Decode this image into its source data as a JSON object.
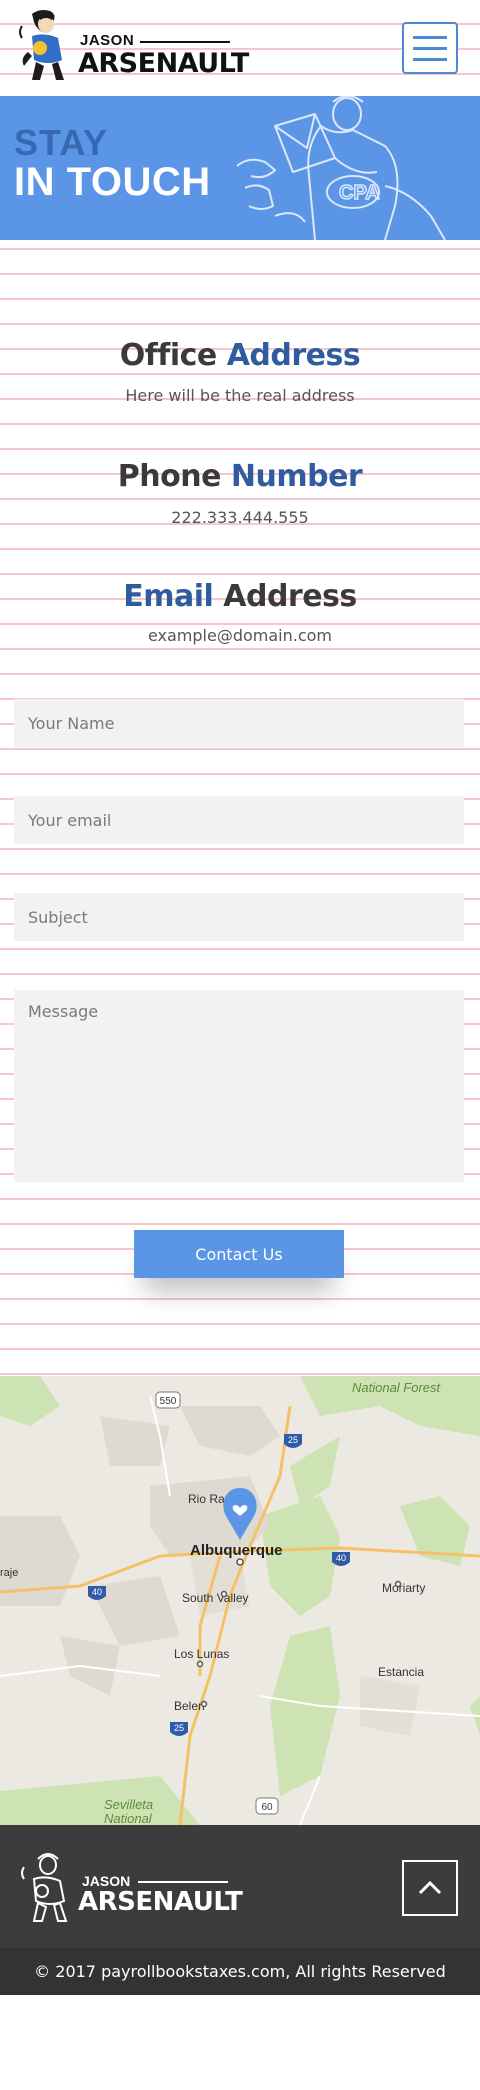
{
  "header": {
    "logo_first": "JASON",
    "logo_last": "ARSENAULT",
    "menu_icon": "hamburger-menu-icon"
  },
  "banner": {
    "line1": "STAY",
    "line2": "IN TOUCH",
    "badge_text": "CPA"
  },
  "contact_info": {
    "office": {
      "title_dark": "Office",
      "title_blue": "Address",
      "value": "Here will be the real address"
    },
    "phone": {
      "title_dark": "Phone",
      "title_blue": "Number",
      "value": "222.333.444.555"
    },
    "email": {
      "title_blue": "Email",
      "title_dark": "Address",
      "value": "example@domain.com"
    }
  },
  "form": {
    "name_placeholder": "Your Name",
    "email_placeholder": "Your email",
    "subject_placeholder": "Subject",
    "message_placeholder": "Message",
    "submit_label": "Contact Us"
  },
  "map": {
    "labels": {
      "national_forest": "National Forest",
      "rio_rancho": "Rio Rancho",
      "albuquerque": "Albuquerque",
      "south_valley": "South Valley",
      "moriarty": "Moriarty",
      "los_lunas": "Los Lunas",
      "estancia": "Estancia",
      "belen": "Belen",
      "sevilleta": "Sevilleta",
      "national": "National",
      "raje": "raje"
    },
    "shields": {
      "r550": "550",
      "i25_north": "25",
      "i40_east": "40",
      "i40_west": "40",
      "i25_south": "25",
      "r60": "60"
    }
  },
  "footer": {
    "logo_first": "JASON",
    "logo_last": "ARSENAULT",
    "to_top_icon": "chevron-up-icon",
    "copyright": "© 2017 payrollbookstaxes.com, All rights Reserved"
  },
  "colors": {
    "accent": "#5b96e6",
    "title_blue": "#2f5c9e",
    "footer_dark": "#3c3c3c"
  }
}
